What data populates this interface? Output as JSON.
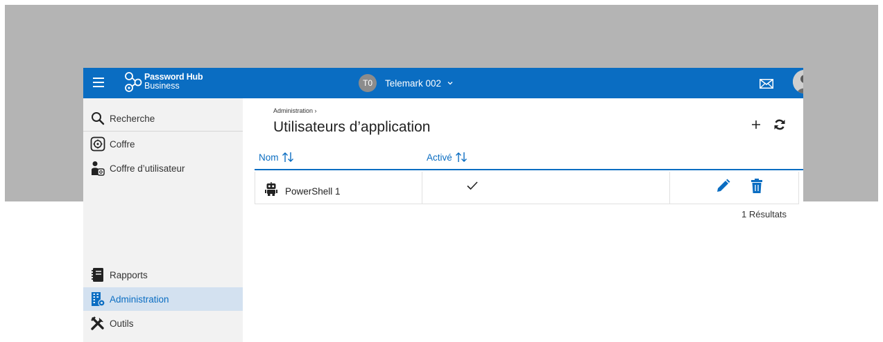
{
  "colors": {
    "brand": "#0a6dc2",
    "sidebar_bg": "#f2f2f2",
    "active_bg": "#d3e1f0",
    "backdrop": "#b4b4b4"
  },
  "header": {
    "logo_line1": "Password Hub",
    "logo_line2": "Business",
    "tenant_initials": "T0",
    "tenant_name": "Telemark 002",
    "icons": [
      "menu-icon",
      "logo-icon",
      "chevron-down-icon",
      "mail-icon",
      "user-avatar"
    ]
  },
  "sidebar": {
    "top_items": [
      {
        "label": "Recherche",
        "icon": "search-icon"
      },
      {
        "label": "Coffre",
        "icon": "vault-icon"
      },
      {
        "label": "Coffre d’utilisateur",
        "icon": "user-vault-icon"
      }
    ],
    "bottom_items": [
      {
        "label": "Rapports",
        "icon": "report-icon"
      },
      {
        "label": "Administration",
        "icon": "admin-building-icon",
        "active": true
      },
      {
        "label": "Outils",
        "icon": "tools-icon"
      }
    ]
  },
  "main": {
    "breadcrumb": "Administration",
    "title": "Utilisateurs d’application",
    "toolbar": {
      "add_icon": "plus-icon",
      "refresh_icon": "refresh-icon"
    },
    "table": {
      "columns": [
        "Nom",
        "Activé"
      ],
      "rows": [
        {
          "name": "PowerShell 1",
          "active": true,
          "icon": "robot-icon"
        }
      ]
    },
    "results": "1 Résultats"
  }
}
